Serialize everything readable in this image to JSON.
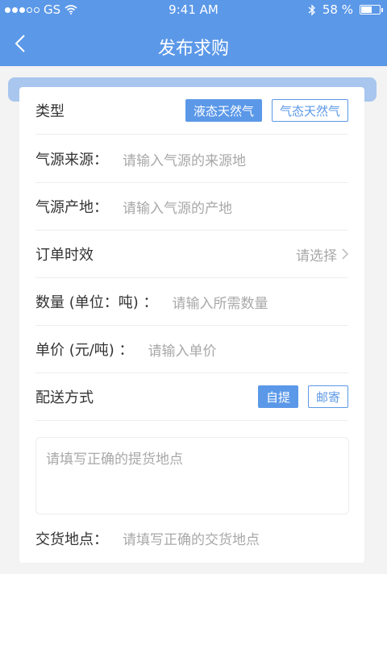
{
  "status_bar": {
    "carrier": "GS",
    "time": "9:41 AM",
    "battery": "58 %",
    "signal_dots": 5,
    "signal_filled": 3,
    "battery_level": 0.58
  },
  "header": {
    "title": "发布求购",
    "back_icon": "chevron-left-icon",
    "color": "#5b98e8"
  },
  "form": {
    "type": {
      "label": "类型",
      "options": [
        {
          "label": "液态天然气",
          "selected": true
        },
        {
          "label": "气态天然气",
          "selected": false
        }
      ]
    },
    "gas_source": {
      "label": "气源来源：",
      "placeholder": "请输入气源的来源地"
    },
    "gas_origin": {
      "label": "气源产地：",
      "placeholder": "请输入气源的产地"
    },
    "order_validity": {
      "label": "订单时效",
      "value": "请选择"
    },
    "quantity": {
      "label": "数量 (单位：吨) ：",
      "placeholder": "请输入所需数量"
    },
    "unit_price": {
      "label": "单价 (元/吨) ：",
      "placeholder": "请输入单价"
    },
    "delivery_method": {
      "label": "配送方式",
      "options": [
        {
          "label": "自提",
          "selected": true
        },
        {
          "label": "邮寄",
          "selected": false
        }
      ]
    },
    "pickup_address": {
      "placeholder": "请填写正确的提货地点"
    },
    "delivery_place": {
      "label": "交货地点：",
      "placeholder": "请填写正确的交货地点"
    }
  }
}
